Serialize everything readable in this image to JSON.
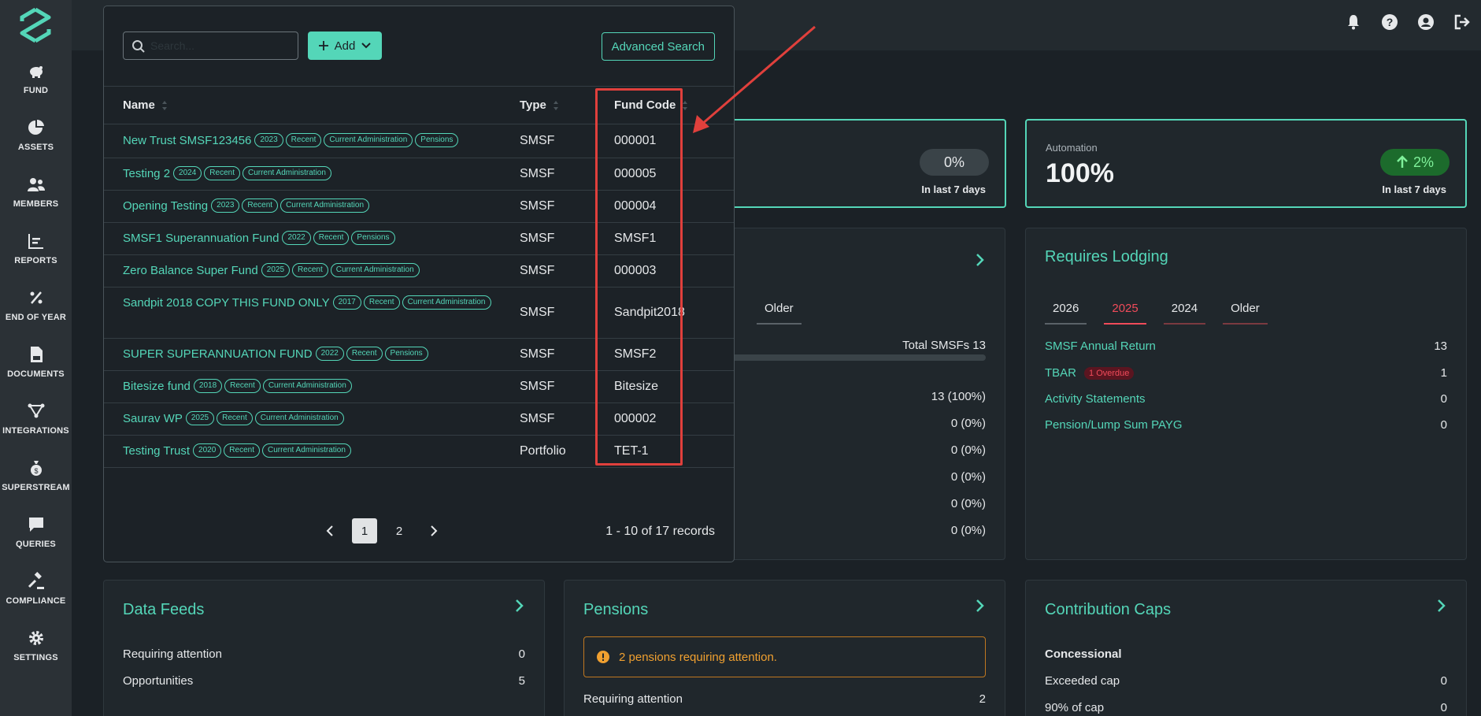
{
  "sidebar": {
    "items": [
      {
        "label": "FUND",
        "icon": "piggy-bank-icon"
      },
      {
        "label": "ASSETS",
        "icon": "pie-chart-icon"
      },
      {
        "label": "MEMBERS",
        "icon": "users-icon"
      },
      {
        "label": "REPORTS",
        "icon": "bar-chart-icon"
      },
      {
        "label": "END OF YEAR",
        "icon": "percent-icon"
      },
      {
        "label": "DOCUMENTS",
        "icon": "pdf-file-icon"
      },
      {
        "label": "INTEGRATIONS",
        "icon": "network-icon"
      },
      {
        "label": "SUPERSTREAM",
        "icon": "money-bag-icon"
      },
      {
        "label": "QUERIES",
        "icon": "chat-icon"
      },
      {
        "label": "COMPLIANCE",
        "icon": "gavel-icon"
      },
      {
        "label": "SETTINGS",
        "icon": "gear-icon"
      }
    ]
  },
  "topbar": {
    "icons": [
      "bell-icon",
      "help-icon",
      "user-icon",
      "logout-icon"
    ]
  },
  "stats": {
    "card1": {
      "pill": "0%",
      "caption": "In last 7 days"
    },
    "automation": {
      "label": "Automation",
      "value": "100%",
      "pill": "2%",
      "caption": "In last 7 days"
    }
  },
  "middle_card": {
    "tab_older": "Older",
    "total": "Total SMSFs 13",
    "values": [
      "13 (100%)",
      "0 (0%)",
      "0 (0%)",
      "0 (0%)",
      "0 (0%)",
      "0 (0%)"
    ]
  },
  "requires_lodging": {
    "title": "Requires Lodging",
    "tabs": [
      "2026",
      "2025",
      "2024",
      "Older"
    ],
    "rows": [
      {
        "label": "SMSF Annual Return",
        "value": "13"
      },
      {
        "label": "TBAR",
        "badge": "1 Overdue",
        "value": "1"
      },
      {
        "label": "Activity Statements",
        "value": "0"
      },
      {
        "label": "Pension/Lump Sum PAYG",
        "value": "0"
      }
    ]
  },
  "data_feeds": {
    "title": "Data Feeds",
    "rows": [
      {
        "label": "Requiring attention",
        "value": "0"
      },
      {
        "label": "Opportunities",
        "value": "5"
      }
    ]
  },
  "pensions": {
    "title": "Pensions",
    "alert": "2 pensions requiring attention.",
    "rows": [
      {
        "label": "Requiring attention",
        "value": "2"
      }
    ]
  },
  "contribution_caps": {
    "title": "Contribution Caps",
    "subheading": "Concessional",
    "rows": [
      {
        "label": "Exceeded cap",
        "value": "0"
      },
      {
        "label": "90% of cap",
        "value": "0"
      }
    ]
  },
  "search_popup": {
    "search_placeholder": "Search...",
    "add_label": "Add",
    "advanced_label": "Advanced Search",
    "columns": [
      "Name",
      "Type",
      "Fund Code"
    ],
    "rows": [
      {
        "name": "New Trust SMSF123456",
        "badges": [
          "2023",
          "Recent",
          "Current Administration",
          "Pensions"
        ],
        "type": "SMSF",
        "code": "000001"
      },
      {
        "name": "Testing 2",
        "badges": [
          "2024",
          "Recent",
          "Current Administration"
        ],
        "type": "SMSF",
        "code": "000005"
      },
      {
        "name": "Opening Testing",
        "badges": [
          "2023",
          "Recent",
          "Current Administration"
        ],
        "type": "SMSF",
        "code": "000004"
      },
      {
        "name": "SMSF1 Superannuation Fund",
        "badges": [
          "2022",
          "Recent",
          "Pensions"
        ],
        "type": "SMSF",
        "code": "SMSF1"
      },
      {
        "name": "Zero Balance Super Fund",
        "badges": [
          "2025",
          "Recent",
          "Current Administration"
        ],
        "type": "SMSF",
        "code": "000003"
      },
      {
        "name": "Sandpit 2018 COPY THIS FUND ONLY",
        "badges": [
          "2017",
          "Recent",
          "Current Administration"
        ],
        "type": "SMSF",
        "code": "Sandpit2018"
      },
      {
        "name": "SUPER SUPERANNUATION FUND",
        "badges": [
          "2022",
          "Recent",
          "Pensions"
        ],
        "type": "SMSF",
        "code": "SMSF2"
      },
      {
        "name": "Bitesize fund",
        "badges": [
          "2018",
          "Recent",
          "Current Administration"
        ],
        "type": "SMSF",
        "code": "Bitesize"
      },
      {
        "name": "Saurav WP",
        "badges": [
          "2025",
          "Recent",
          "Current Administration"
        ],
        "type": "SMSF",
        "code": "000002"
      },
      {
        "name": "Testing Trust",
        "badges": [
          "2020",
          "Recent",
          "Current Administration"
        ],
        "type": "Portfolio",
        "code": "TET-1"
      }
    ],
    "pagination": {
      "pages": [
        "1",
        "2"
      ],
      "current": "1",
      "summary": "1 - 10 of 17 records"
    }
  },
  "colors": {
    "accent": "#54d6b8",
    "danger": "#f04b5a",
    "annotation": "#e0403c",
    "warning": "#f0a030"
  }
}
